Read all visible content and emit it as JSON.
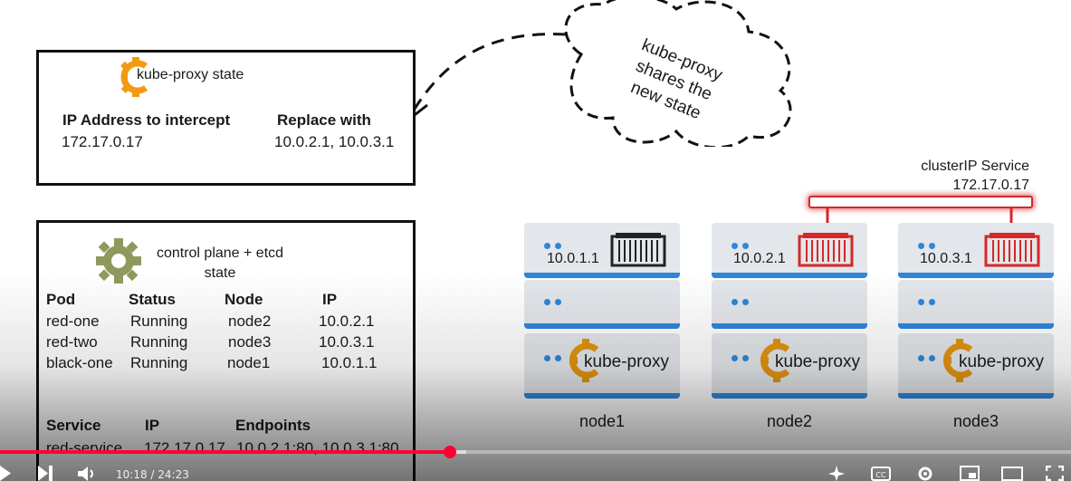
{
  "cloud": {
    "text_line1": "kube-proxy",
    "text_line2": "shares the",
    "text_line3": "new state",
    "text_prefix": "kube-"
  },
  "kubeproxy_state": {
    "title": "kube-proxy state",
    "col1_header": "IP Address to intercept",
    "col2_header": "Replace with",
    "col1_value": "172.17.0.17",
    "col2_value": "10.0.2.1, 10.0.3.1"
  },
  "control_plane": {
    "title_line1": "control plane + etcd",
    "title_line2": "state",
    "pod_headers": [
      "Pod",
      "Status",
      "Node",
      "IP"
    ],
    "pods": [
      [
        "red-one",
        "Running",
        "node2",
        "10.0.2.1"
      ],
      [
        "red-two",
        "Running",
        "node3",
        "10.0.3.1"
      ],
      [
        "black-one",
        "Running",
        "node1",
        "10.0.1.1"
      ]
    ],
    "service_headers": [
      "Service",
      "IP",
      "Endpoints"
    ],
    "services": [
      [
        "red-service",
        "172.17.0.17",
        "10.0.2.1:80, 10.0.3.1:80"
      ]
    ]
  },
  "cluster_service": {
    "line1": "clusterIP Service",
    "line2": "172.17.0.17"
  },
  "nodes": [
    {
      "name": "node1",
      "ip": "10.0.1.1",
      "proxy": "kube-proxy",
      "container_color": "#222222"
    },
    {
      "name": "node2",
      "ip": "10.0.2.1",
      "proxy": "kube-proxy",
      "container_color": "#d62828"
    },
    {
      "name": "node3",
      "ip": "10.0.3.1",
      "proxy": "kube-proxy",
      "container_color": "#d62828"
    }
  ],
  "player": {
    "time_current": "10:18",
    "time_total": "24:23",
    "progress": 0.42,
    "buffered": 0.435,
    "accent": "#ff0033"
  }
}
